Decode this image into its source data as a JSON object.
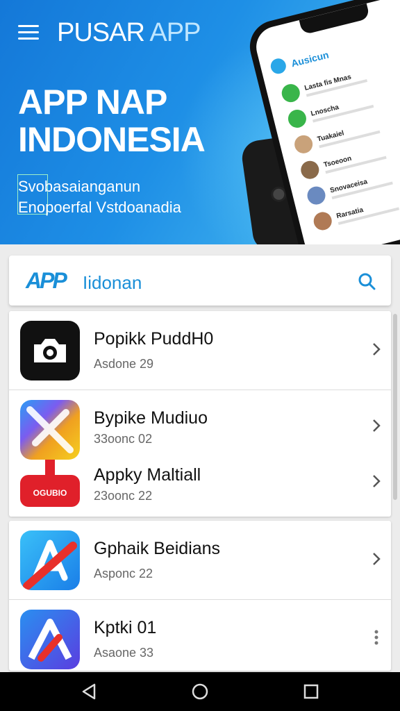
{
  "header": {
    "brand_main": "PUSAR",
    "brand_accent": " APP",
    "hero_title_line1": "APP NAP",
    "hero_title_line2": "INDONESIA",
    "hero_sub_line1": "Svobasaianganun",
    "hero_sub_line2": "Enopoerfal Vstdoanadia"
  },
  "phone_mock": {
    "title": "Ausicun",
    "rows": [
      "Lasta fis Mnas",
      "Lnoscha",
      "Tuakaiel",
      "Tsoeoon",
      "Snovaceisa",
      "Rarsatia"
    ]
  },
  "search": {
    "logo": "APP",
    "text": "Iidonan"
  },
  "apps": [
    {
      "name": "Popikk PuddН0",
      "meta": "Asdone 29"
    },
    {
      "name": "Bypikе Mudiuo",
      "meta": "33oonc 02"
    },
    {
      "name": "Appky Maltiall",
      "meta": "23oonc 22",
      "icon_badge": "OGUBIO"
    },
    {
      "name": "Gphaik Beidians",
      "meta": "Asponc 22"
    },
    {
      "name": "Kptki 01",
      "meta": "Asaone 33"
    }
  ],
  "colors": {
    "accent": "#1a8fd8",
    "hero_start": "#1478d8",
    "hero_end": "#4fc0f2"
  }
}
